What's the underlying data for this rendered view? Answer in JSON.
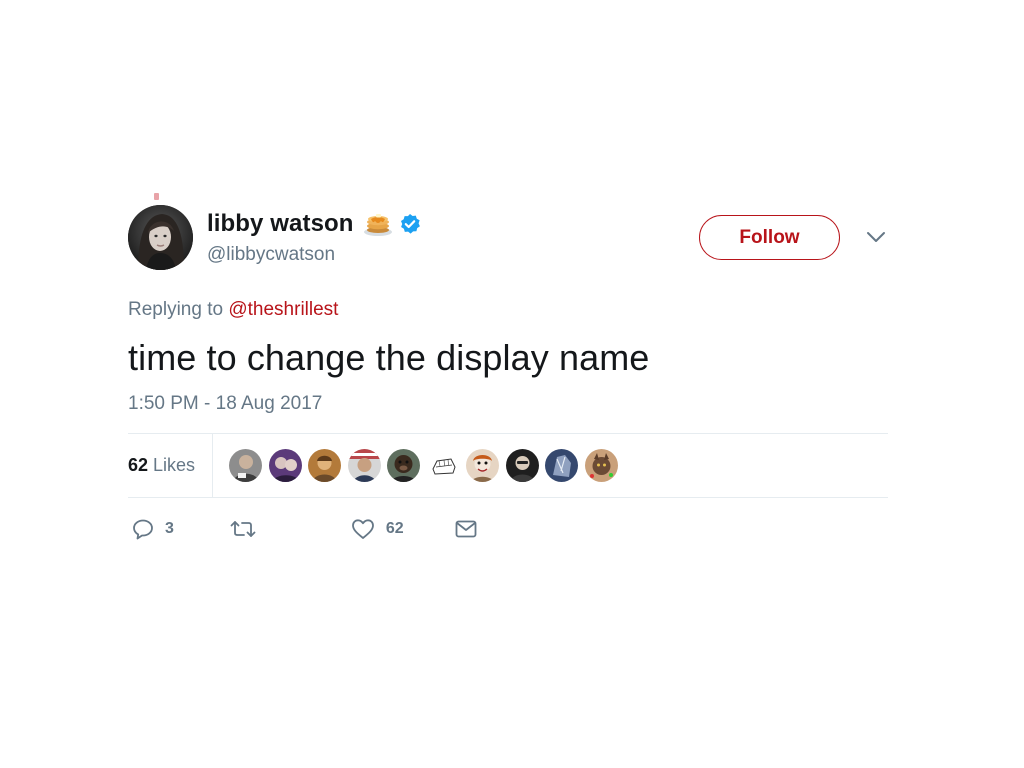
{
  "user": {
    "display_name": "libby watson",
    "handle": "@libbycwatson",
    "name_emoji": "pancakes-icon",
    "verified": true
  },
  "header": {
    "follow_label": "Follow",
    "menu_icon": "chevron-down-icon"
  },
  "tweet": {
    "replying_prefix": "Replying to",
    "replying_to": "@theshrillest",
    "text": "time to change the display name",
    "timestamp": "1:50 PM - 18 Aug 2017"
  },
  "stats": {
    "likes_count": "62",
    "likes_label": "Likes",
    "liker_avatars": 9
  },
  "actions": {
    "reply_count": "3",
    "retweet_count": "",
    "like_count": "62"
  },
  "colors": {
    "accent": "#b8141a",
    "muted": "#657786",
    "text": "#14171a",
    "divider": "#e6ecf0",
    "verified": "#1da1f2"
  }
}
